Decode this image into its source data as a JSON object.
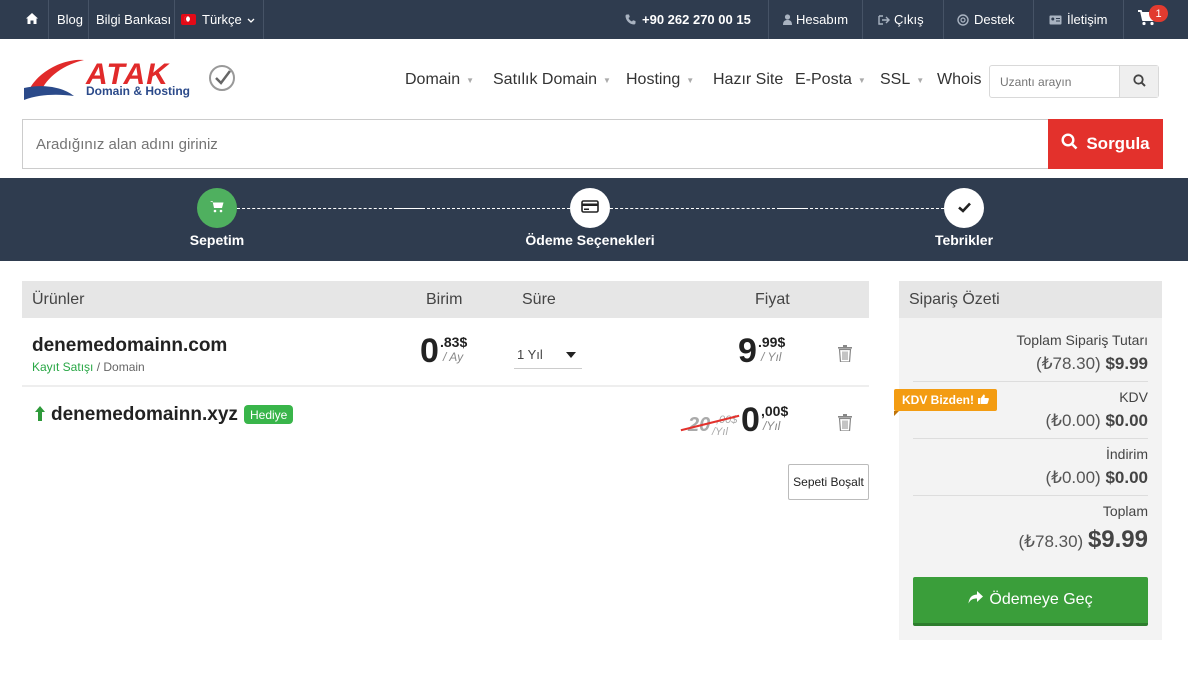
{
  "topbar": {
    "blog": "Blog",
    "knowledge_base": "Bilgi Bankası",
    "language": "Türkçe",
    "phone": "+90 262 270 00 15",
    "account": "Hesabım",
    "logout": "Çıkış",
    "support": "Destek",
    "contact": "İletişim",
    "cart_count": "1"
  },
  "logo": {
    "name": "ATAK",
    "tagline": "Domain & Hosting"
  },
  "nav": {
    "domain": "Domain",
    "domain_for_sale": "Satılık Domain",
    "hosting": "Hosting",
    "ready_site": "Hazır Site",
    "email": "E-Posta",
    "ssl": "SSL",
    "whois": "Whois",
    "search_placeholder": "Uzantı arayın"
  },
  "domain_search": {
    "placeholder": "Aradığınız alan adını giriniz",
    "button": "Sorgula"
  },
  "steps": [
    {
      "label": "Sepetim",
      "active": true
    },
    {
      "label": "Ödeme Seçenekleri",
      "active": false
    },
    {
      "label": "Tebrikler",
      "active": false
    }
  ],
  "cart": {
    "headers": {
      "products": "Ürünler",
      "unit": "Birim",
      "duration": "Süre",
      "price": "Fiyat"
    },
    "items": [
      {
        "domain": "denemedomainn.com",
        "type_label": "Kayıt Satışı",
        "category": "/ Domain",
        "unit_int": "0",
        "unit_frac": ".83$",
        "unit_per": "/ Ay",
        "duration": "1 Yıl",
        "price_int": "9",
        "price_frac": ".99$",
        "price_per": "/ Yıl"
      },
      {
        "domain": "denemedomainn.xyz",
        "badge": "Hediye",
        "old_int": "20",
        "old_frac": ",00$",
        "old_per": "/Yıl",
        "price_int": "0",
        "price_frac": ",00$",
        "price_per": "/Yıl"
      }
    ],
    "empty_button": "Sepeti Boşalt"
  },
  "summary": {
    "title": "Sipariş Özeti",
    "kdv_badge": "KDV Bizden!",
    "rows": [
      {
        "label": "Toplam Sipariş Tutarı",
        "try": "(₺78.30)",
        "usd": "$9.99"
      },
      {
        "label": "KDV",
        "try": "(₺0.00)",
        "usd": "$0.00"
      },
      {
        "label": "İndirim",
        "try": "(₺0.00)",
        "usd": "$0.00"
      },
      {
        "label": "Toplam",
        "try": "(₺78.30)",
        "usd": "$9.99"
      }
    ],
    "pay_button": "Ödemeye Geç"
  },
  "colors": {
    "topbar": "#2f3c4f",
    "accent_red": "#e3312c",
    "green": "#3a9e3a",
    "badge_orange": "#f39c12"
  }
}
